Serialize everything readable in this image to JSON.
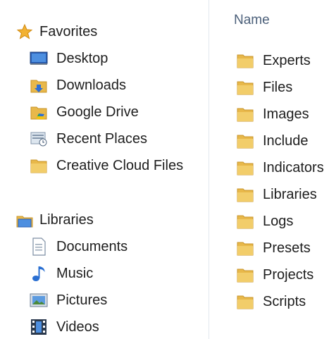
{
  "nav": {
    "favorites": {
      "label": "Favorites",
      "icon": "star-icon",
      "items": [
        {
          "label": "Desktop",
          "icon": "desktop-icon"
        },
        {
          "label": "Downloads",
          "icon": "downloads-folder-icon"
        },
        {
          "label": "Google Drive",
          "icon": "google-drive-folder-icon"
        },
        {
          "label": "Recent Places",
          "icon": "recent-places-icon"
        },
        {
          "label": "Creative Cloud Files",
          "icon": "folder-icon"
        }
      ]
    },
    "libraries": {
      "label": "Libraries",
      "icon": "libraries-icon",
      "items": [
        {
          "label": "Documents",
          "icon": "documents-icon"
        },
        {
          "label": "Music",
          "icon": "music-icon"
        },
        {
          "label": "Pictures",
          "icon": "pictures-icon"
        },
        {
          "label": "Videos",
          "icon": "videos-icon"
        }
      ]
    }
  },
  "content": {
    "column_header": "Name",
    "files": [
      {
        "name": "Experts",
        "icon": "folder-icon"
      },
      {
        "name": "Files",
        "icon": "folder-icon"
      },
      {
        "name": "Images",
        "icon": "folder-icon"
      },
      {
        "name": "Include",
        "icon": "folder-icon"
      },
      {
        "name": "Indicators",
        "icon": "folder-icon"
      },
      {
        "name": "Libraries",
        "icon": "folder-icon"
      },
      {
        "name": "Logs",
        "icon": "folder-icon"
      },
      {
        "name": "Presets",
        "icon": "folder-icon"
      },
      {
        "name": "Projects",
        "icon": "folder-icon"
      },
      {
        "name": "Scripts",
        "icon": "folder-icon"
      }
    ]
  },
  "colors": {
    "folder": "#e8b84a",
    "header_text": "#4c607a",
    "divider": "#e2e8ef"
  }
}
